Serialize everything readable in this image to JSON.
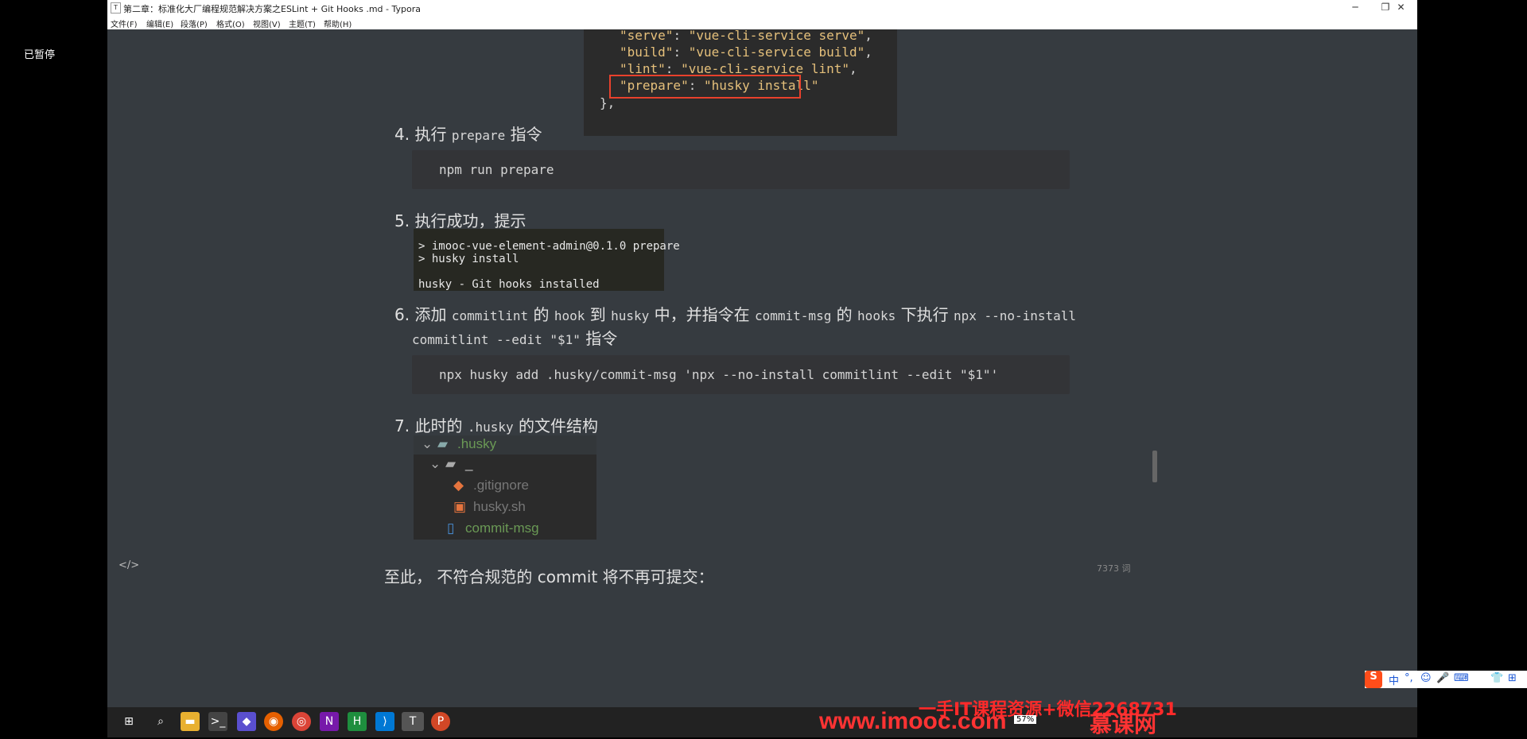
{
  "overlay": {
    "paused_label": "已暂停"
  },
  "window": {
    "title": "第二章：标准化大厂编程规范解决方案之ESLint + Git Hooks .md - Typora",
    "controls": {
      "minimize": "─",
      "maximize": "❐",
      "close": "✕"
    }
  },
  "menu": [
    "文件(F)",
    "编辑(E)",
    "段落(P)",
    "格式(O)",
    "视图(V)",
    "主题(T)",
    "帮助(H)"
  ],
  "package_json": {
    "lines": [
      {
        "key": "\"serve\"",
        "sep": ": ",
        "val": "\"vue-cli-service serve\"",
        "end": ","
      },
      {
        "key": "\"build\"",
        "sep": ": ",
        "val": "\"vue-cli-service build\"",
        "end": ","
      },
      {
        "key": "\"lint\"",
        "sep": ": ",
        "val": "\"vue-cli-service lint\"",
        "end": ","
      },
      {
        "key": "\"prepare\"",
        "sep": ": ",
        "val": "\"husky install\"",
        "end": ""
      }
    ],
    "closing": "},"
  },
  "steps": {
    "s4": {
      "num": "4.",
      "pre": "执行 ",
      "code": "prepare",
      "post": " 指令",
      "block": "npm run prepare"
    },
    "s5": {
      "num": "5.",
      "text": "执行成功，提示",
      "terminal": [
        "> imooc-vue-element-admin@0.1.0 prepare",
        "> husky install",
        "",
        "husky - Git hooks installed"
      ]
    },
    "s6": {
      "num": "6.",
      "p1": "添加 ",
      "c1": "commitlint",
      "p2": " 的 ",
      "c2": "hook",
      "p3": " 到 ",
      "c3": "husky",
      "p4": " 中，并指令在 ",
      "c4": "commit-msg",
      "p5": " 的 ",
      "c5": "hooks",
      "p6": " 下执行 ",
      "c6": "npx --no-install",
      "c7": "commitlint --edit \"$1\"",
      "p7": " 指令",
      "block": "npx husky add .husky/commit-msg 'npx --no-install commitlint --edit \"$1\"'"
    },
    "s7": {
      "num": "7.",
      "pre": "此时的 ",
      "code": ".husky",
      "post": " 的文件结构",
      "tree": [
        ".husky",
        "_",
        ".gitignore",
        "husky.sh",
        "commit-msg"
      ]
    }
  },
  "conclusion": {
    "pre": "至此， 不符合规范的 ",
    "word": "commit",
    "post": " 将不再可提交："
  },
  "status": {
    "word_count": "7373 词"
  },
  "taskbar": {
    "battery": "57%",
    "watermark_top": "一手IT课程资源+微信2268731",
    "watermark_url": "www.imooc.com",
    "watermark_brand": "慕课网"
  },
  "ime": {
    "items": [
      "S",
      "中",
      "°,",
      "☺",
      "🎤",
      "⌨",
      "👕",
      "⊞"
    ]
  },
  "colors": {
    "accent_red": "#E8412C",
    "string_yellow": "#E5C07B",
    "tree_green": "#6A9955"
  }
}
